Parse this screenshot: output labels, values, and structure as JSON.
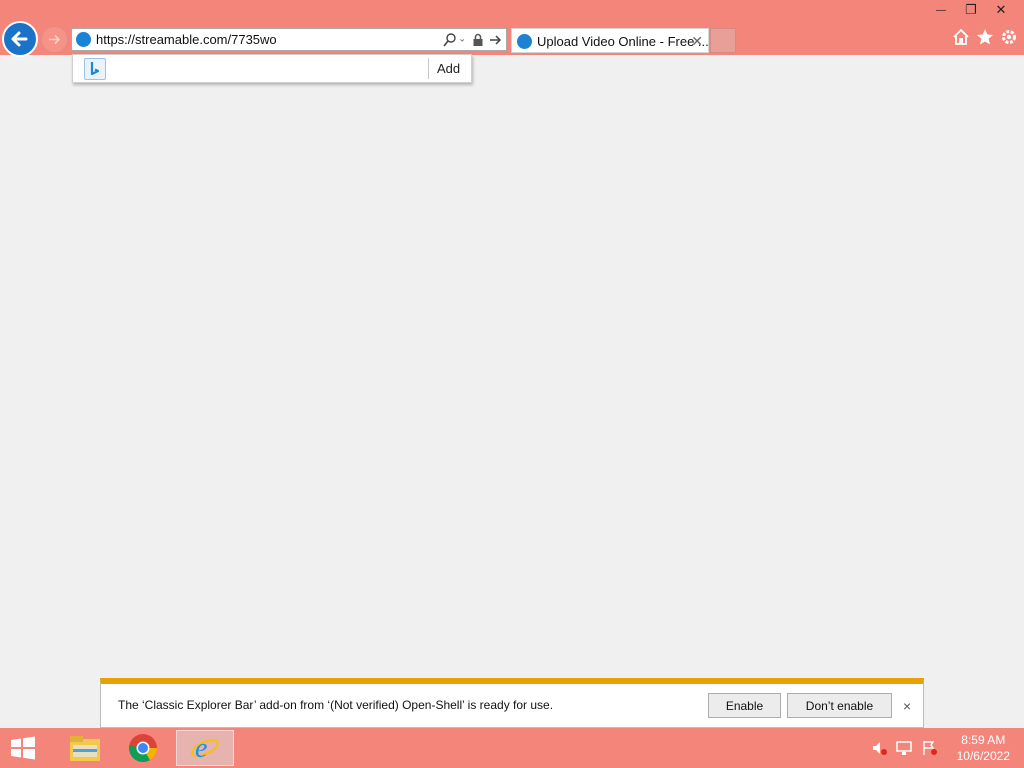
{
  "browser": {
    "address_url": "https://streamable.com/7735wo",
    "tab_title": "Upload Video Online - Free ...",
    "suggest_add_label": "Add",
    "accent_color": "#f4857b"
  },
  "window_controls": {
    "minimize": "—",
    "restore": "❐",
    "close": "✕"
  },
  "notification": {
    "message": "The ‘Classic Explorer Bar’ add-on from ‘(Not verified) Open-Shell’ is ready for use.",
    "enable_label": "Enable",
    "dont_enable_label": "Don’t enable",
    "close_glyph": "×"
  },
  "taskbar": {
    "time": "8:59 AM",
    "date": "10/6/2022",
    "apps": [
      "file-explorer-icon",
      "chrome-icon",
      "internet-explorer-icon"
    ]
  },
  "icons": {
    "tab_close": "✕"
  }
}
